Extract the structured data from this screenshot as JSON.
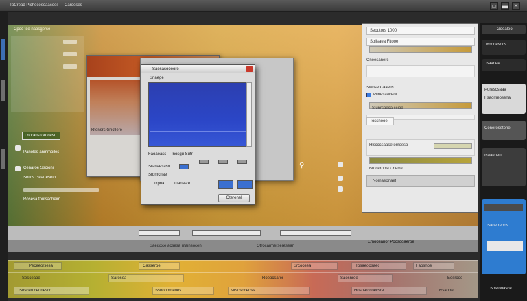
{
  "window": {
    "title": "ToCread Pichecosoaacoes",
    "menu": "Caroeses",
    "buttons": [
      "▭",
      "▬",
      "✕"
    ]
  },
  "workspace": {
    "title": "Cpoc tce naosgerse",
    "left_panel": {
      "header": "Lhorans Grocesl",
      "rows": [
        "Panoles anmmoiles",
        "Cenaroe Sscionr",
        "Sollcs Geatreseld",
        "Rosesa foulsacheim"
      ]
    }
  },
  "back_window": {
    "label": "Rtensrs Gnctlere"
  },
  "dialog": {
    "title": "Saesasooeore",
    "subtitle": "Snaege",
    "labels": [
      "Faoaeass",
      "Inosgu Sutr",
      "Sranaesasd",
      "Srbmcnae",
      "Trpna",
      "Ittanasre"
    ],
    "ok_label": "Oterenel"
  },
  "properties": {
    "header": "Seoutors 1000",
    "row1": "Spilsaea Fitooe",
    "row2": "Cneesanerc",
    "section1": "Swose Caaelis",
    "section1_sub": "Piinesaaceoll",
    "row3": "Siunrsaeca ccioa",
    "row4": "Tossnooe",
    "section2": "Hlscccsaasetomosso",
    "row5": "Broceroosl Cherrel",
    "row6": "Nomaeonaet"
  },
  "farright": {
    "header": "Goealeo",
    "items": [
      "Rdonesocs",
      "Saanee",
      "Porescsaaa",
      "Fsaomeosena",
      "Cenerosetone",
      "Isaaenerl",
      "Saoe reoos",
      "Sosrooasce"
    ]
  },
  "transport": {
    "status": "Saeisxce acsesa mainsocen",
    "center": "Otrocarmerseresean",
    "right": "Emoosanor Pocsooaeroe"
  },
  "timeline": {
    "rows": [
      [
        "Peceeorsesa",
        "Casseroe",
        "Srcoosea",
        "Tosaeoosaec",
        "Faosnoe"
      ],
      [
        "Sesceaoe",
        "Sarosea",
        "Roeocsarer",
        "Saosnroe",
        "Eosrooe"
      ],
      [
        "Sosceo ceonescr",
        "Ssoooomeoes",
        "Mrsosoceoss",
        "Hosoarccoecsre",
        "Rsaooe"
      ]
    ]
  },
  "colors": {
    "accent_blue": "#2b46c7",
    "timeline_orange": "#e1b135"
  }
}
